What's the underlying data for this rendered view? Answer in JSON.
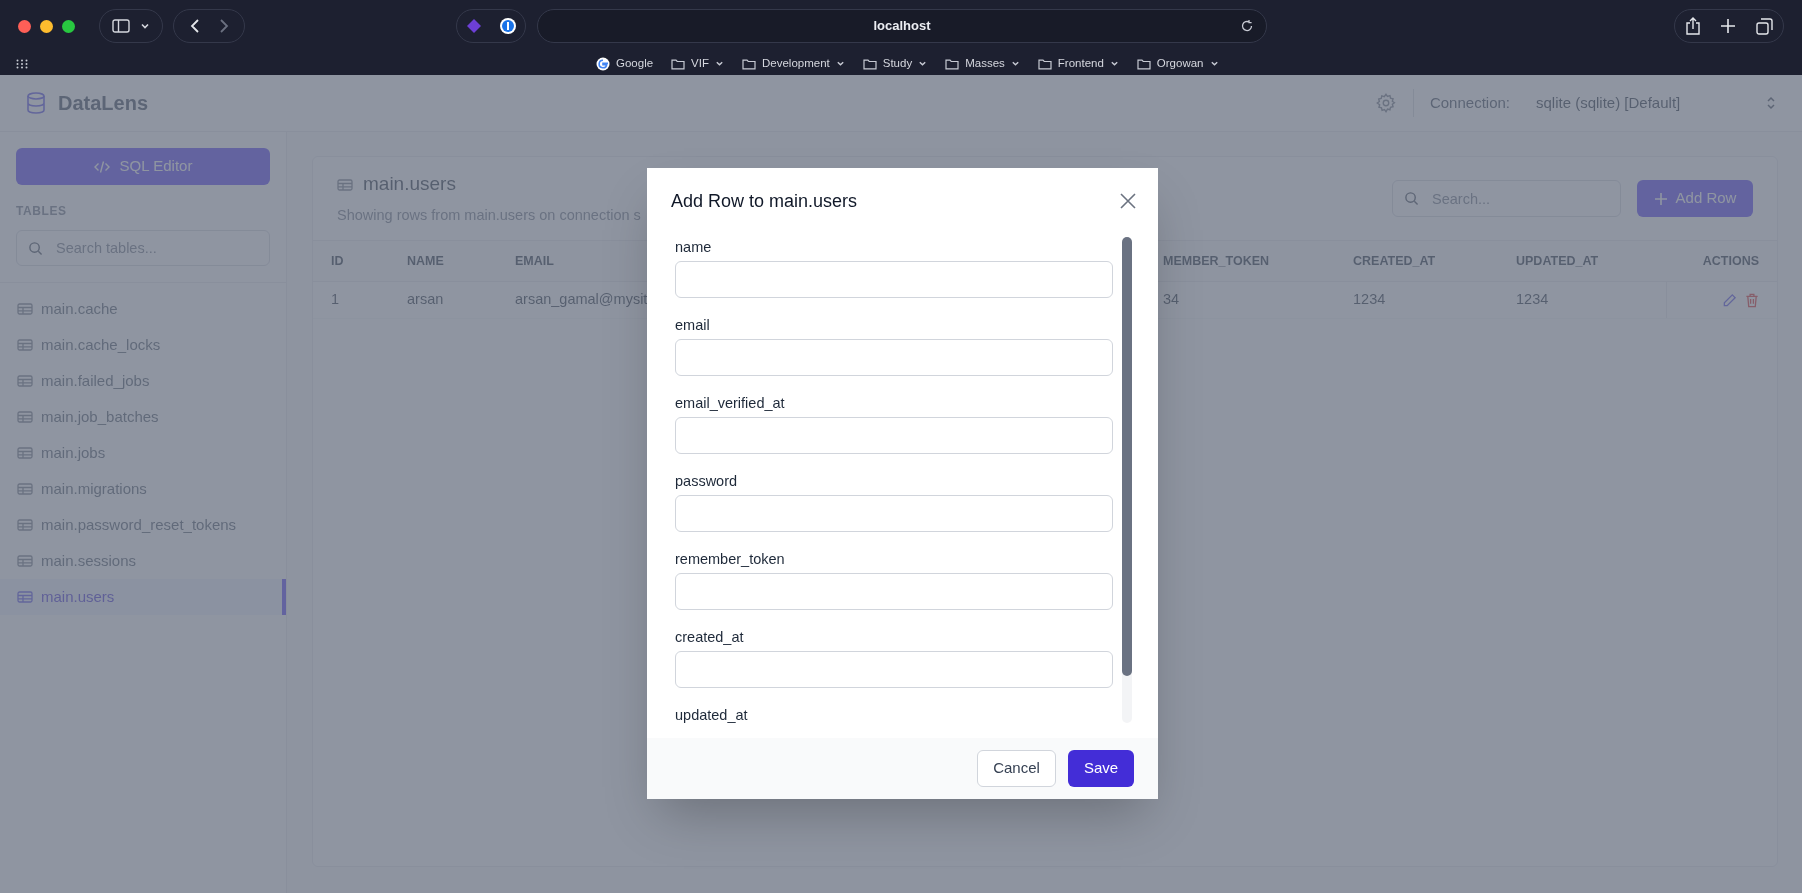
{
  "browser": {
    "url": "localhost",
    "bookmarks": [
      {
        "kind": "site",
        "label": "Google"
      },
      {
        "kind": "folder",
        "label": "VIF"
      },
      {
        "kind": "folder",
        "label": "Development"
      },
      {
        "kind": "folder",
        "label": "Study"
      },
      {
        "kind": "folder",
        "label": "Masses"
      },
      {
        "kind": "folder",
        "label": "Frontend"
      },
      {
        "kind": "folder",
        "label": "Orgowan"
      }
    ]
  },
  "header": {
    "app_name": "DataLens",
    "connection_label": "Connection:",
    "connection_value": "sqlite (sqlite) [Default]"
  },
  "sidebar": {
    "sql_editor_button": "SQL Editor",
    "section_title": "TABLES",
    "search": {
      "placeholder": "Search tables..."
    },
    "items": [
      {
        "label": "main.cache",
        "selected": false
      },
      {
        "label": "main.cache_locks",
        "selected": false
      },
      {
        "label": "main.failed_jobs",
        "selected": false
      },
      {
        "label": "main.job_batches",
        "selected": false
      },
      {
        "label": "main.jobs",
        "selected": false
      },
      {
        "label": "main.migrations",
        "selected": false
      },
      {
        "label": "main.password_reset_tokens",
        "selected": false
      },
      {
        "label": "main.sessions",
        "selected": false
      },
      {
        "label": "main.users",
        "selected": true
      }
    ]
  },
  "table_panel": {
    "title": "main.users",
    "subtitle": "Showing rows from main.users on connection s",
    "search": {
      "placeholder": "Search..."
    },
    "add_button": "Add Row",
    "columns": [
      "ID",
      "NAME",
      "EMAIL",
      "MEMBER_TOKEN",
      "CREATED_AT",
      "UPDATED_AT",
      "ACTIONS"
    ],
    "rows": [
      {
        "cells": [
          "1",
          "arsan",
          "arsan_gamal@mysit",
          "34",
          "1234",
          "1234"
        ]
      }
    ]
  },
  "modal": {
    "title": "Add Row to main.users",
    "fields": [
      {
        "label": "name"
      },
      {
        "label": "email"
      },
      {
        "label": "email_verified_at"
      },
      {
        "label": "password"
      },
      {
        "label": "remember_token"
      },
      {
        "label": "created_at"
      },
      {
        "label": "updated_at"
      }
    ],
    "cancel_button": "Cancel",
    "save_button": "Save"
  }
}
